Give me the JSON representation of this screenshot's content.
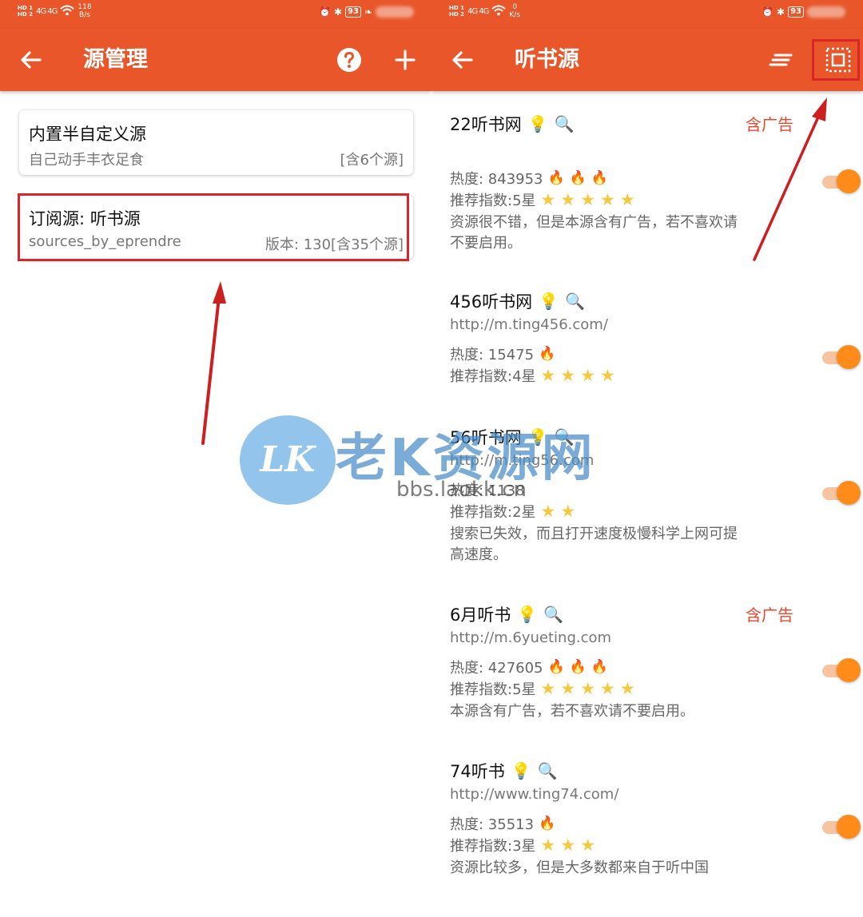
{
  "status_left": {
    "hd_top": "HD 1",
    "hd_bottom": "HD 2",
    "signal": "4G 4G",
    "speed_value": "118",
    "speed_unit": "B/s"
  },
  "status_right": {
    "hd_top": "HD 1",
    "hd_bottom": "HD 2",
    "signal": "4G 4G",
    "speed_value": "0",
    "speed_unit": "K/s"
  },
  "battery": "93",
  "left_panel": {
    "title": "源管理",
    "cards": [
      {
        "title": "内置半自定义源",
        "subtitle": "自己动手丰衣足食",
        "meta": "[含6个源]"
      },
      {
        "title": "订阅源: 听书源",
        "subtitle": "sources_by_eprendre",
        "meta": "版本: 130[含35个源]"
      }
    ]
  },
  "right_panel": {
    "title": "听书源",
    "sources": [
      {
        "name": "22听书网",
        "ad": "含广告",
        "url": "",
        "heat_label": "热度: 843953",
        "heat_level": 3,
        "rating_label": "推荐指数:5星",
        "stars": 5,
        "desc1": "资源很不错，但是本源含有广告，若不喜欢请",
        "desc2": "不要启用。",
        "enabled": true
      },
      {
        "name": "456听书网",
        "ad": "",
        "url": "http://m.ting456.com/",
        "heat_label": "热度: 15475",
        "heat_level": 1,
        "rating_label": "推荐指数:4星",
        "stars": 4,
        "desc1": "",
        "desc2": "",
        "enabled": true
      },
      {
        "name": "56听书网",
        "ad": "",
        "url": "http://m.ting56.com",
        "heat_label": "热度: 1138",
        "heat_level": 0,
        "rating_label": "推荐指数:2星",
        "stars": 2,
        "desc1": "搜索已失效，而且打开速度极慢科学上网可提",
        "desc2": "高速度。",
        "enabled": true
      },
      {
        "name": "6月听书",
        "ad": "含广告",
        "url": "http://m.6yueting.com",
        "heat_label": "热度: 427605",
        "heat_level": 3,
        "rating_label": "推荐指数:5星",
        "stars": 5,
        "desc1": "本源含有广告，若不喜欢请不要启用。",
        "desc2": "",
        "enabled": true
      },
      {
        "name": "74听书",
        "ad": "",
        "url": "http://www.ting74.com/",
        "heat_label": "热度: 35513",
        "heat_level": 1,
        "rating_label": "推荐指数:3星",
        "stars": 3,
        "desc1": "资源比较多，但是大多数都来自于听中国",
        "desc2": "",
        "enabled": true
      }
    ]
  },
  "watermark": {
    "logo": "LK",
    "text": "老K资源网",
    "url": "bbs.laokk.cn"
  },
  "colors": {
    "primary": "#e8562a",
    "ad_text": "#e8462a",
    "toggle_thumb": "#ff8c1a",
    "toggle_track": "#f8c4a0",
    "highlight": "#d9262a"
  },
  "icons": {
    "back": "arrow-left-icon",
    "help": "help-circle-icon",
    "add": "plus-icon",
    "sort": "sort-lines-icon",
    "select": "select-all-icon",
    "bulb": "lightbulb-icon",
    "search": "magnifier-icon",
    "fire": "fire-icon",
    "star": "star-icon"
  }
}
